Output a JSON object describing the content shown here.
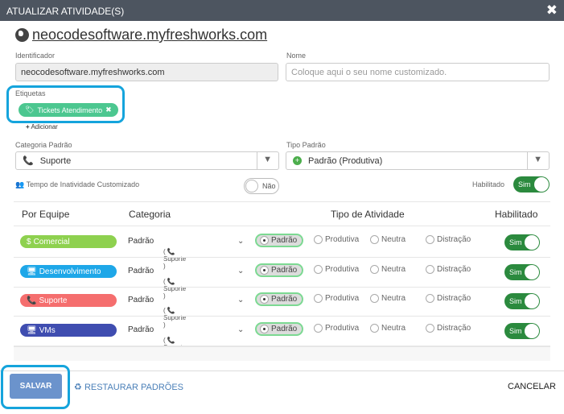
{
  "window": {
    "title": "ATUALIZAR ATIVIDADE(S)",
    "close_icon": "✖"
  },
  "site": {
    "domain": "neocodesoftware.myfreshworks.com",
    "icon": "globe-icon"
  },
  "form": {
    "identifier_label": "Identificador",
    "identifier_value": "neocodesoftware.myfreshworks.com",
    "name_label": "Nome",
    "name_placeholder": "Coloque aqui o seu nome customizado.",
    "tags_label": "Etiquetas",
    "tag": "Tickets Atendimento",
    "add_label": "Adicionar",
    "category_label": "Categoria Padrão",
    "category_value": "Suporte",
    "type_label": "Tipo Padrão",
    "type_value": "Padrão (Produtiva)",
    "inactivity_label": "Tempo de Inatividade Customizado",
    "inactivity_toggle": "Não",
    "enabled_label": "Habilitado",
    "enabled_toggle": "Sim"
  },
  "table": {
    "headers": {
      "team": "Por Equipe",
      "category": "Categoria",
      "type": "Tipo de Atividade",
      "enabled": "Habilitado"
    },
    "rows": [
      {
        "team": "Comercial",
        "team_icon": "$",
        "color": "#8ed14f",
        "category": "Padrão",
        "subcategory": "Suporte",
        "options": [
          "Padrão",
          "Produtiva",
          "Neutra",
          "Distração"
        ],
        "selected": "Padrão",
        "enabled": "Sim"
      },
      {
        "team": "Desenvolvimento",
        "team_icon": "monitor-icon",
        "color": "#1ea7e8",
        "category": "Padrão",
        "subcategory": "Suporte",
        "options": [
          "Padrão",
          "Produtiva",
          "Neutra",
          "Distração"
        ],
        "selected": "Padrão",
        "enabled": "Sim"
      },
      {
        "team": "Suporte",
        "team_icon": "phone-icon",
        "color": "#f56e6e",
        "category": "Padrão",
        "subcategory": "Suporte",
        "options": [
          "Padrão",
          "Produtiva",
          "Neutra",
          "Distração"
        ],
        "selected": "Padrão",
        "enabled": "Sim"
      },
      {
        "team": "VMs",
        "team_icon": "monitor-icon",
        "color": "#3f4db0",
        "category": "Padrão",
        "subcategory": "Suporte",
        "options": [
          "Padrão",
          "Produtiva",
          "Neutra",
          "Distração"
        ],
        "selected": "Padrão",
        "enabled": "Sim"
      }
    ]
  },
  "footer": {
    "save": "SALVAR",
    "restore": "RESTAURAR PADRÕES",
    "cancel": "CANCELAR"
  }
}
